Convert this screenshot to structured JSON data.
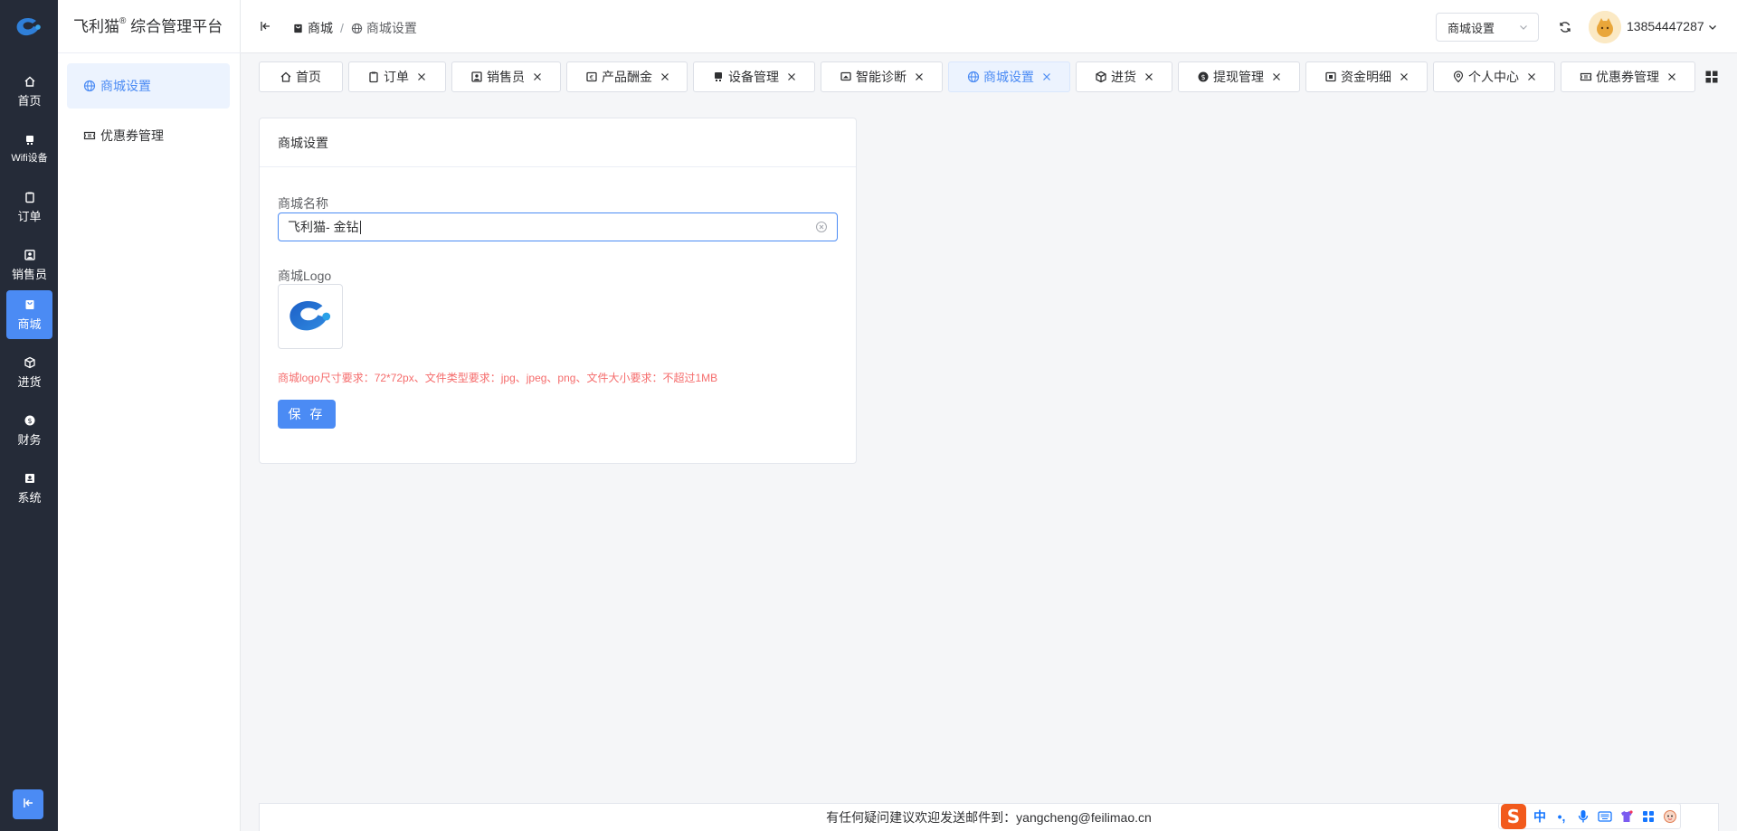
{
  "app": {
    "brand_name": "飞利猫",
    "brand_mark": "®",
    "brand_suffix": " 综合管理平台"
  },
  "rail": {
    "items": [
      {
        "label": "首页",
        "icon": "home-icon"
      },
      {
        "label": "Wifi设备",
        "icon": "device-icon"
      },
      {
        "label": "订单",
        "icon": "clipboard-icon"
      },
      {
        "label": "销售员",
        "icon": "person-card-icon"
      },
      {
        "label": "商城",
        "icon": "shop-bag-icon",
        "active": true
      },
      {
        "label": "进货",
        "icon": "box-icon"
      },
      {
        "label": "财务",
        "icon": "money-icon"
      },
      {
        "label": "系统",
        "icon": "system-icon"
      }
    ]
  },
  "subnav": {
    "items": [
      {
        "label": "商城设置",
        "icon": "globe-icon",
        "active": true
      },
      {
        "label": "优惠券管理",
        "icon": "ticket-icon"
      }
    ]
  },
  "header": {
    "breadcrumb": [
      {
        "label": "商城",
        "icon": "shop-bag-icon"
      },
      {
        "label": "商城设置",
        "icon": "globe-icon"
      }
    ],
    "separator": "/",
    "select_value": "商城设置",
    "username": "13854447287"
  },
  "tabs": [
    {
      "label": "首页",
      "icon": "home-icon",
      "closable": false
    },
    {
      "label": "订单",
      "icon": "clipboard-icon",
      "closable": true
    },
    {
      "label": "销售员",
      "icon": "person-card-icon",
      "closable": true
    },
    {
      "label": "产品酬金",
      "icon": "currency-icon",
      "closable": true
    },
    {
      "label": "设备管理",
      "icon": "device-icon",
      "closable": true
    },
    {
      "label": "智能诊断",
      "icon": "monitor-icon",
      "closable": true
    },
    {
      "label": "商城设置",
      "icon": "globe-icon",
      "closable": true,
      "active": true
    },
    {
      "label": "进货",
      "icon": "box-icon",
      "closable": true
    },
    {
      "label": "提现管理",
      "icon": "money-icon",
      "closable": true
    },
    {
      "label": "资金明细",
      "icon": "ledger-icon",
      "closable": true
    },
    {
      "label": "个人中心",
      "icon": "location-user-icon",
      "closable": true
    },
    {
      "label": "优惠券管理",
      "icon": "ticket-icon",
      "closable": true
    }
  ],
  "card": {
    "title": "商城设置",
    "name_label": "商城名称",
    "name_value": "飞利猫- 金钻",
    "logo_label": "商城Logo",
    "hint": "商城logo尺寸要求：72*72px、文件类型要求：jpg、jpeg、png、文件大小要求：不超过1MB",
    "save_label": "保 存"
  },
  "footer": {
    "text": "有任何疑问建议欢迎发送邮件到：yangcheng@feilimao.cn"
  },
  "ime": {
    "logo": "S",
    "mode": "中",
    "punct": "•,"
  },
  "colors": {
    "accent": "#4b8bf4",
    "rail_bg": "#252b38",
    "hint": "#f56c6c"
  }
}
